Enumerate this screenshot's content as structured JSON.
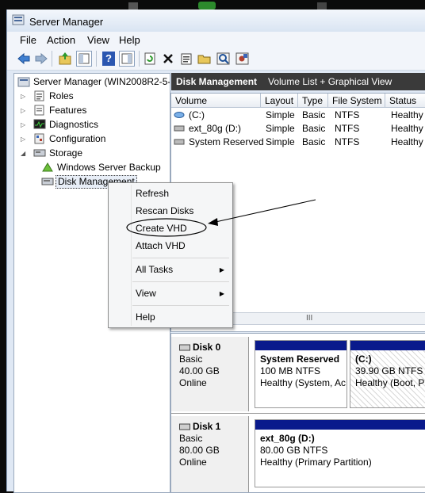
{
  "window": {
    "title": "Server Manager"
  },
  "menu": [
    "File",
    "Action",
    "View",
    "Help"
  ],
  "toolbar": {
    "icons": [
      "back-arrow-icon",
      "forward-arrow-icon",
      "up-folder-icon",
      "show-hide-tree-icon",
      "help-icon",
      "console-tree-icon",
      "refresh-icon",
      "delete-icon",
      "properties-icon",
      "open-icon",
      "search-icon",
      "settings-icon"
    ]
  },
  "tree": {
    "root": "Server Manager (WIN2008R2-5-4",
    "roles": "Roles",
    "features": "Features",
    "diagnostics": "Diagnostics",
    "configuration": "Configuration",
    "storage": "Storage",
    "backup": "Windows Server Backup",
    "disk_mgmt": "Disk Management"
  },
  "header": {
    "title": "Disk Management",
    "subtitle": "Volume List + Graphical View"
  },
  "volume_list": {
    "columns": [
      "Volume",
      "Layout",
      "Type",
      "File System",
      "Status"
    ],
    "rows": [
      [
        "(C:)",
        "Simple",
        "Basic",
        "NTFS",
        "Healthy"
      ],
      [
        "ext_80g (D:)",
        "Simple",
        "Basic",
        "NTFS",
        "Healthy"
      ],
      [
        "System Reserved",
        "Simple",
        "Basic",
        "NTFS",
        "Healthy"
      ]
    ],
    "scroll_grip": "III"
  },
  "context_menu": {
    "refresh": "Refresh",
    "rescan": "Rescan Disks",
    "create_vhd": "Create VHD",
    "attach_vhd": "Attach VHD",
    "all_tasks": "All Tasks",
    "view": "View",
    "help": "Help"
  },
  "disks": [
    {
      "name": "Disk 0",
      "type": "Basic",
      "size": "40.00 GB",
      "status": "Online",
      "partitions": [
        {
          "name": "System Reserved",
          "size": "100 MB NTFS",
          "status": "Healthy (System, Ac"
        },
        {
          "name": "(C:)",
          "size": "39.90 GB NTFS",
          "status": "Healthy (Boot, P"
        }
      ]
    },
    {
      "name": "Disk 1",
      "type": "Basic",
      "size": "80.00 GB",
      "status": "Online",
      "partitions": [
        {
          "name": "ext_80g  (D:)",
          "size": "80.00 GB NTFS",
          "status": "Healthy (Primary Partition)"
        }
      ]
    }
  ],
  "colors": {
    "header_bg": "#3a3a3a",
    "partition_bar": "#0a1a8c",
    "window_bg": "#dfe8f4",
    "screen_bg": "#0b0b0b"
  }
}
